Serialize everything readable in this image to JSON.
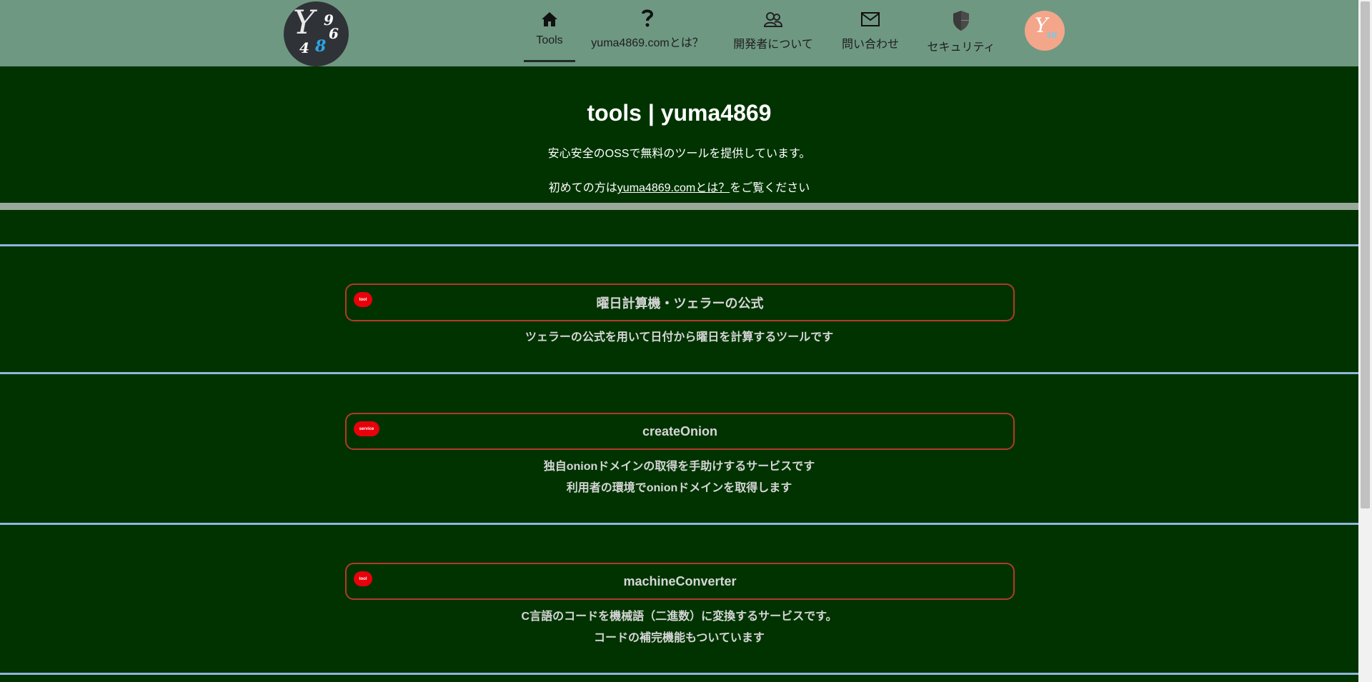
{
  "header": {
    "logo": {
      "chars": [
        "Y",
        "9",
        "6",
        "4",
        "8"
      ]
    },
    "nav": [
      {
        "label": "Tools",
        "icon": "home-icon",
        "active": true
      },
      {
        "label": "yuma4869.comとは？",
        "icon": "question-icon"
      },
      {
        "label": "開発者について",
        "icon": "people-icon"
      },
      {
        "label": "問い合わせ",
        "icon": "mail-icon"
      },
      {
        "label": "セキュリティ",
        "icon": "shield-icon"
      }
    ],
    "avatar": {
      "chars": [
        "Y",
        "48"
      ]
    }
  },
  "hero": {
    "title": "tools | yuma4869",
    "subtitle": "安心安全のOSSで無料のツールを提供しています。",
    "intro_prefix": "初めての方は",
    "intro_link": "yuma4869.comとは？",
    "intro_suffix": "をご覧ください"
  },
  "cards": [
    {
      "badge": "tool",
      "title": "曜日計算機・ツェラーの公式",
      "desc": [
        "ツェラーの公式を用いて日付から曜日を計算するツールです"
      ]
    },
    {
      "badge": "service",
      "title": "createOnion",
      "desc": [
        "独自onionドメインの取得を手助けするサービスです",
        "利用者の環境でonionドメインを取得します"
      ]
    },
    {
      "badge": "tool",
      "title": "machineConverter",
      "desc": [
        "C言語のコードを機械語（二進数）に変換するサービスです。",
        "コードの補完機能もついています"
      ]
    }
  ],
  "colors": {
    "background": "#003300",
    "header": "#6e9882",
    "divider": "#8fb6de",
    "card_border": "#b23a2a",
    "badge": "#e8000a"
  }
}
